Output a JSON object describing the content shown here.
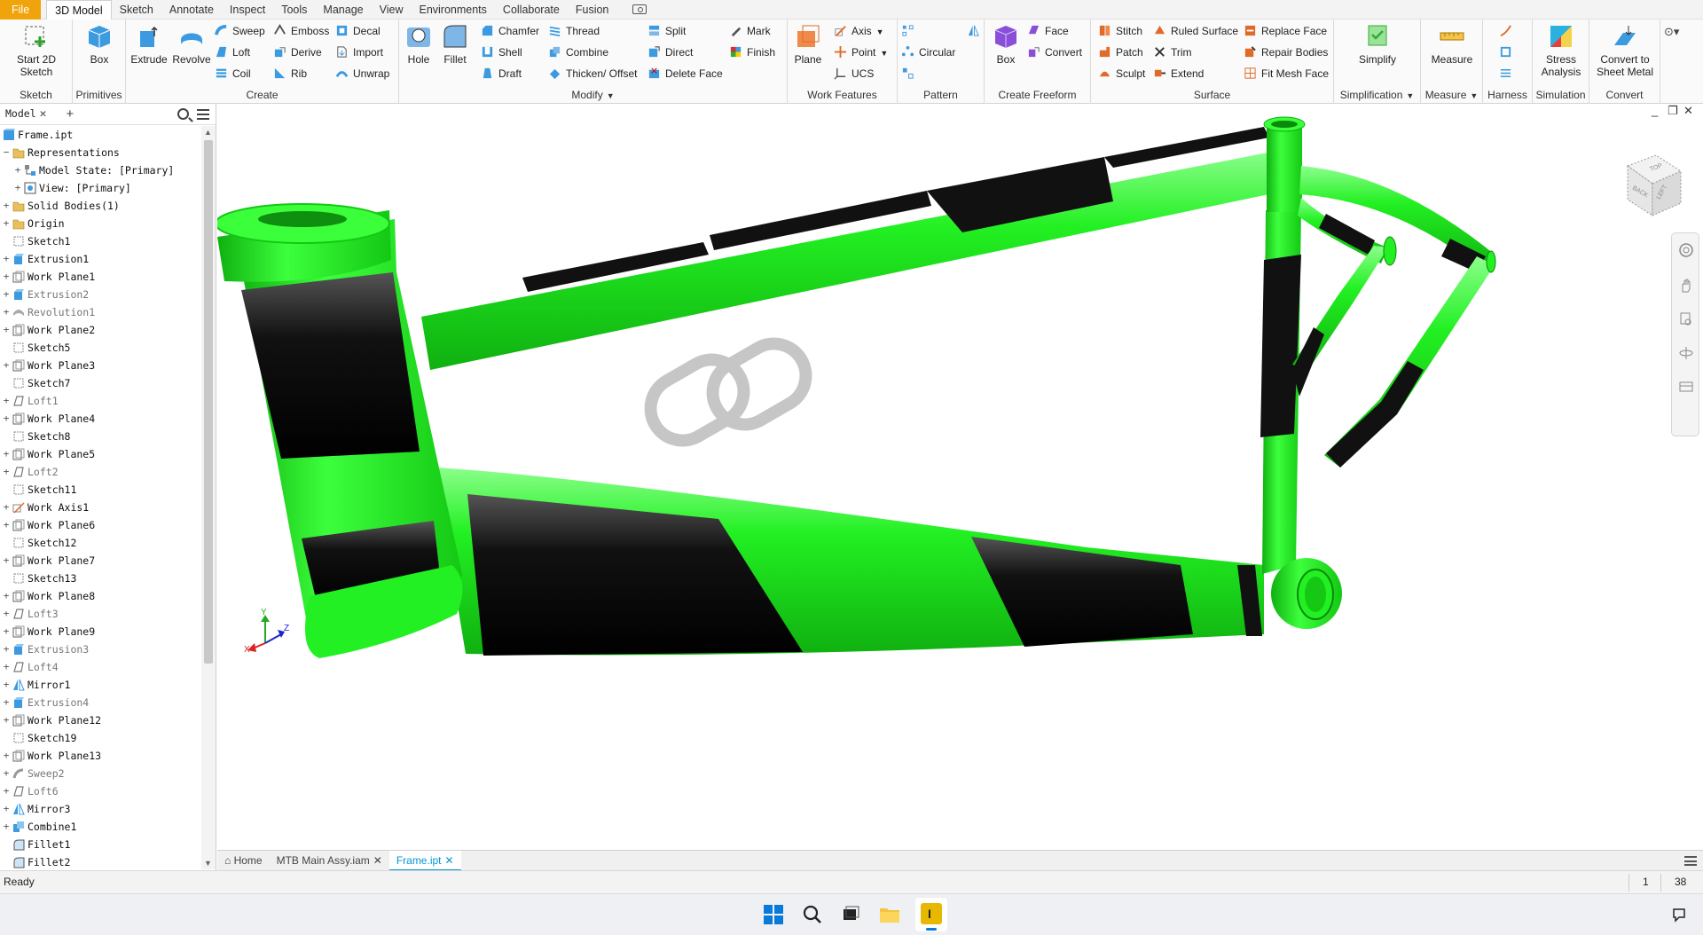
{
  "menu": {
    "tabs": [
      "File",
      "3D Model",
      "Sketch",
      "Annotate",
      "Inspect",
      "Tools",
      "Manage",
      "View",
      "Environments",
      "Collaborate",
      "Fusion"
    ],
    "active_tab": "3D Model"
  },
  "ribbon": {
    "sketch": {
      "start_sketch": "Start 2D Sketch",
      "label": "Sketch"
    },
    "primitives": {
      "box": "Box",
      "label": "Primitives"
    },
    "create": {
      "extrude": "Extrude",
      "revolve": "Revolve",
      "sweep": "Sweep",
      "loft": "Loft",
      "coil": "Coil",
      "emboss": "Emboss",
      "derive": "Derive",
      "rib": "Rib",
      "decal": "Decal",
      "import": "Import",
      "unwrap": "Unwrap",
      "label": "Create"
    },
    "modify": {
      "hole": "Hole",
      "fillet": "Fillet",
      "chamfer": "Chamfer",
      "shell": "Shell",
      "draft": "Draft",
      "thread": "Thread",
      "combine": "Combine",
      "thicken": "Thicken/ Offset",
      "split": "Split",
      "direct": "Direct",
      "delete_face": "Delete Face",
      "mark": "Mark",
      "finish": "Finish",
      "label": "Modify"
    },
    "work_features": {
      "plane": "Plane",
      "axis": "Axis",
      "point": "Point",
      "ucs": "UCS",
      "label": "Work Features"
    },
    "pattern": {
      "circular": "Circular",
      "label": "Pattern"
    },
    "create_freeform": {
      "box": "Box",
      "face": "Face",
      "convert": "Convert",
      "label": "Create Freeform"
    },
    "surface": {
      "stitch": "Stitch",
      "patch": "Patch",
      "sculpt": "Sculpt",
      "ruled_surface": "Ruled Surface",
      "trim": "Trim",
      "extend": "Extend",
      "replace_face": "Replace Face",
      "repair_bodies": "Repair Bodies",
      "fit_mesh_face": "Fit Mesh Face",
      "label": "Surface"
    },
    "simplification": {
      "simplify": "Simplify",
      "label": "Simplification"
    },
    "measure": {
      "measure": "Measure",
      "label": "Measure"
    },
    "harness": {
      "label": "Harness"
    },
    "simulation": {
      "stress": "Stress Analysis",
      "label": "Simulation"
    },
    "convert": {
      "sheet_metal": "Convert to Sheet Metal",
      "label": "Convert"
    }
  },
  "browser": {
    "tab": "Model",
    "items": [
      {
        "label": "Frame.ipt",
        "icon": "part-icon",
        "exp": "",
        "lvl": 0,
        "dim": false
      },
      {
        "label": "Representations",
        "icon": "folder-icon",
        "exp": "−",
        "lvl": 0,
        "dim": false
      },
      {
        "label": "Model State: [Primary]",
        "icon": "model-state-icon",
        "exp": "+",
        "lvl": 1,
        "dim": false
      },
      {
        "label": "View: [Primary]",
        "icon": "view-icon",
        "exp": "+",
        "lvl": 1,
        "dim": false
      },
      {
        "label": "Solid Bodies(1)",
        "icon": "folder-icon",
        "exp": "+",
        "lvl": 0,
        "dim": false
      },
      {
        "label": "Origin",
        "icon": "folder-icon",
        "exp": "+",
        "lvl": 0,
        "dim": false
      },
      {
        "label": "Sketch1",
        "icon": "sketch-icon",
        "exp": "",
        "lvl": 0,
        "dim": false
      },
      {
        "label": "Extrusion1",
        "icon": "extrude-icon",
        "exp": "+",
        "lvl": 0,
        "dim": false
      },
      {
        "label": "Work Plane1",
        "icon": "workplane-icon",
        "exp": "+",
        "lvl": 0,
        "dim": false
      },
      {
        "label": "Extrusion2",
        "icon": "extrude-icon",
        "exp": "+",
        "lvl": 0,
        "dim": true
      },
      {
        "label": "Revolution1",
        "icon": "revolve-icon",
        "exp": "+",
        "lvl": 0,
        "dim": true
      },
      {
        "label": "Work Plane2",
        "icon": "workplane-icon",
        "exp": "+",
        "lvl": 0,
        "dim": false
      },
      {
        "label": "Sketch5",
        "icon": "sketch-icon",
        "exp": "",
        "lvl": 0,
        "dim": false
      },
      {
        "label": "Work Plane3",
        "icon": "workplane-icon",
        "exp": "+",
        "lvl": 0,
        "dim": false
      },
      {
        "label": "Sketch7",
        "icon": "sketch-icon",
        "exp": "",
        "lvl": 0,
        "dim": false
      },
      {
        "label": "Loft1",
        "icon": "loft-icon",
        "exp": "+",
        "lvl": 0,
        "dim": true
      },
      {
        "label": "Work Plane4",
        "icon": "workplane-icon",
        "exp": "+",
        "lvl": 0,
        "dim": false
      },
      {
        "label": "Sketch8",
        "icon": "sketch-icon",
        "exp": "",
        "lvl": 0,
        "dim": false
      },
      {
        "label": "Work Plane5",
        "icon": "workplane-icon",
        "exp": "+",
        "lvl": 0,
        "dim": false
      },
      {
        "label": "Loft2",
        "icon": "loft-icon",
        "exp": "+",
        "lvl": 0,
        "dim": true
      },
      {
        "label": "Sketch11",
        "icon": "sketch-icon",
        "exp": "",
        "lvl": 0,
        "dim": false
      },
      {
        "label": "Work Axis1",
        "icon": "workaxis-icon",
        "exp": "+",
        "lvl": 0,
        "dim": false
      },
      {
        "label": "Work Plane6",
        "icon": "workplane-icon",
        "exp": "+",
        "lvl": 0,
        "dim": false
      },
      {
        "label": "Sketch12",
        "icon": "sketch-icon",
        "exp": "",
        "lvl": 0,
        "dim": false
      },
      {
        "label": "Work Plane7",
        "icon": "workplane-icon",
        "exp": "+",
        "lvl": 0,
        "dim": false
      },
      {
        "label": "Sketch13",
        "icon": "sketch-icon",
        "exp": "",
        "lvl": 0,
        "dim": false
      },
      {
        "label": "Work Plane8",
        "icon": "workplane-icon",
        "exp": "+",
        "lvl": 0,
        "dim": false
      },
      {
        "label": "Loft3",
        "icon": "loft-icon",
        "exp": "+",
        "lvl": 0,
        "dim": true
      },
      {
        "label": "Work Plane9",
        "icon": "workplane-icon",
        "exp": "+",
        "lvl": 0,
        "dim": false
      },
      {
        "label": "Extrusion3",
        "icon": "extrude-icon",
        "exp": "+",
        "lvl": 0,
        "dim": true
      },
      {
        "label": "Loft4",
        "icon": "loft-icon",
        "exp": "+",
        "lvl": 0,
        "dim": true
      },
      {
        "label": "Mirror1",
        "icon": "mirror-icon",
        "exp": "+",
        "lvl": 0,
        "dim": false
      },
      {
        "label": "Extrusion4",
        "icon": "extrude-icon",
        "exp": "+",
        "lvl": 0,
        "dim": true
      },
      {
        "label": "Work Plane12",
        "icon": "workplane-icon",
        "exp": "+",
        "lvl": 0,
        "dim": false
      },
      {
        "label": "Sketch19",
        "icon": "sketch-icon",
        "exp": "",
        "lvl": 0,
        "dim": false
      },
      {
        "label": "Work Plane13",
        "icon": "workplane-icon",
        "exp": "+",
        "lvl": 0,
        "dim": false
      },
      {
        "label": "Sweep2",
        "icon": "sweep-icon",
        "exp": "+",
        "lvl": 0,
        "dim": true
      },
      {
        "label": "Loft6",
        "icon": "loft-icon",
        "exp": "+",
        "lvl": 0,
        "dim": true
      },
      {
        "label": "Mirror3",
        "icon": "mirror-icon",
        "exp": "+",
        "lvl": 0,
        "dim": false
      },
      {
        "label": "Combine1",
        "icon": "combine-icon",
        "exp": "+",
        "lvl": 0,
        "dim": false
      },
      {
        "label": "Fillet1",
        "icon": "fillet-icon",
        "exp": "",
        "lvl": 0,
        "dim": false
      },
      {
        "label": "Fillet2",
        "icon": "fillet-icon",
        "exp": "",
        "lvl": 0,
        "dim": false
      }
    ]
  },
  "viewcube": {
    "left": "LEFT",
    "back": "BACK",
    "top": "TOP"
  },
  "triad": {
    "x": "X",
    "y": "Y",
    "z": "Z"
  },
  "documents": {
    "tabs": [
      "Home",
      "MTB Main Assy.iam",
      "Frame.ipt"
    ],
    "active": "Frame.ipt"
  },
  "status": {
    "text": "Ready",
    "n1": "1",
    "n2": "38"
  },
  "colors": {
    "frame_green": "#1ef01e",
    "frame_black": "#111111",
    "accent": "#0696d7",
    "file_tab": "#f0a30a"
  }
}
